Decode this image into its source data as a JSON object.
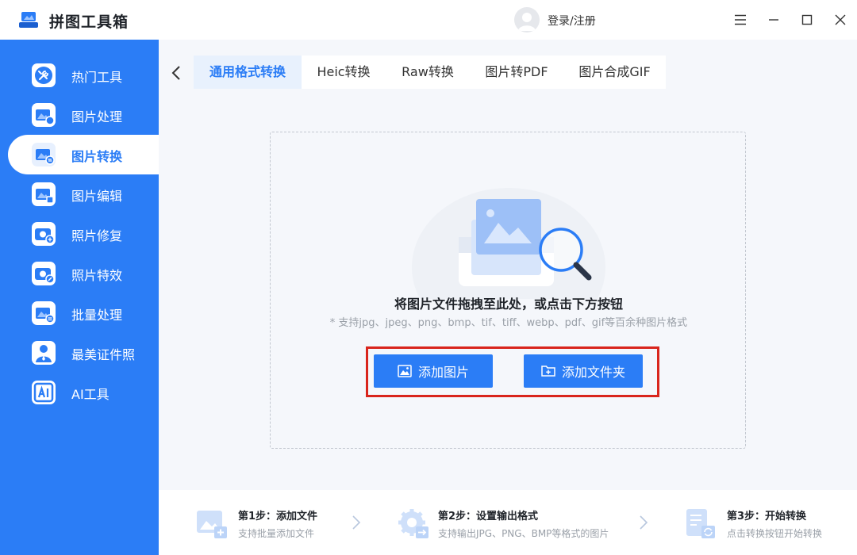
{
  "app": {
    "title": "拼图工具箱",
    "login_label": "登录/注册"
  },
  "sidebar": {
    "items": [
      {
        "label": "热门工具"
      },
      {
        "label": "图片处理"
      },
      {
        "label": "图片转换",
        "active": true
      },
      {
        "label": "图片编辑"
      },
      {
        "label": "照片修复"
      },
      {
        "label": "照片特效"
      },
      {
        "label": "批量处理"
      },
      {
        "label": "最美证件照"
      },
      {
        "label": "AI工具"
      }
    ]
  },
  "tabs": [
    {
      "label": "通用格式转换",
      "active": true
    },
    {
      "label": "Heic转换"
    },
    {
      "label": "Raw转换"
    },
    {
      "label": "图片转PDF"
    },
    {
      "label": "图片合成GIF"
    }
  ],
  "dropzone": {
    "title": "将图片文件拖拽至此处，或点击下方按钮",
    "hint": "* 支持jpg、jpeg、png、bmp、tif、tiff、webp、pdf、gif等百余种图片格式",
    "add_image_label": "添加图片",
    "add_folder_label": "添加文件夹"
  },
  "steps": [
    {
      "title": "第1步：添加文件",
      "desc": "支持批量添加文件"
    },
    {
      "title": "第2步：设置输出格式",
      "desc": "支持输出JPG、PNG、BMP等格式的图片"
    },
    {
      "title": "第3步：开始转换",
      "desc": "点击转换按钮开始转换"
    }
  ],
  "colors": {
    "accent": "#2b7df6",
    "highlight": "#d9251c",
    "background": "#f5f7fb"
  }
}
